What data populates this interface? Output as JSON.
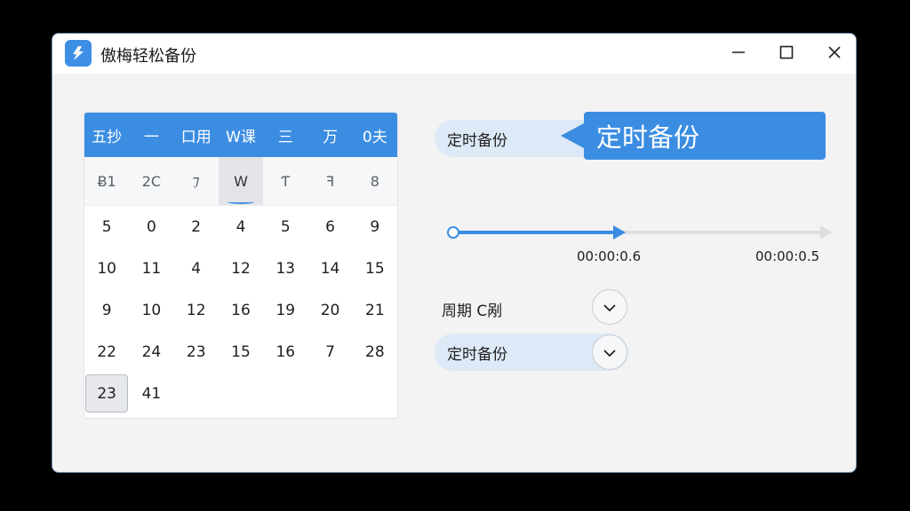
{
  "window": {
    "title": "傲梅轻松备份"
  },
  "titlebar": {
    "app_icon": "app-logo-icon",
    "minimize_icon": "minimize-icon",
    "maximize_icon": "maximize-icon",
    "close_icon": "close-icon"
  },
  "calendar": {
    "header": [
      "五抄",
      "一",
      "口用",
      "W课",
      "三",
      "万",
      "0夫"
    ],
    "subheader": [
      "Ƀ1",
      "2C",
      "ࣹ⁊",
      "W",
      "Ƭ",
      "ꟻ",
      "8"
    ],
    "rows": [
      [
        "5",
        "0",
        "2",
        "4",
        "5",
        "6",
        "9"
      ],
      [
        "10",
        "11",
        "4",
        "12",
        "13",
        "14",
        "15"
      ],
      [
        "9",
        "10",
        "12",
        "16",
        "19",
        "20",
        "21"
      ],
      [
        "22",
        "24",
        "23",
        "15",
        "16",
        "7",
        "28"
      ],
      [
        "23",
        "41",
        "",
        "",
        "",
        "",
        ""
      ]
    ],
    "selected": "23"
  },
  "schedule": {
    "pill_label": "定时备份",
    "callout_label": "定时备份",
    "progress": 0.44,
    "time_current": "00:00:0.6",
    "time_total": "00:00:0.5",
    "period_label": "周期 C剐",
    "backup_dropdown_label": "定时备份"
  },
  "colors": {
    "accent": "#3b8de2",
    "pill": "#dde9f6"
  }
}
